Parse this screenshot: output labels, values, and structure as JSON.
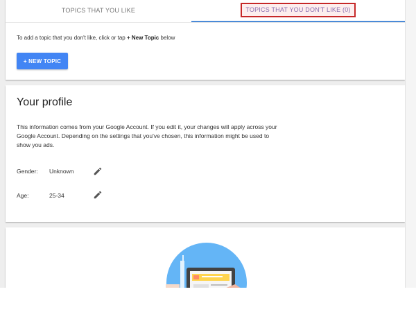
{
  "tabs": {
    "like_label": "TOPICS THAT YOU LIKE",
    "dislike_label": "TOPICS THAT YOU DON'T LIKE (0)",
    "active": "dislike"
  },
  "topics": {
    "help_prefix": "To add a topic that you don't like, click or tap ",
    "help_emphasis": "+ New Topic",
    "help_suffix": " below",
    "new_topic_button": "+ NEW TOPIC"
  },
  "profile": {
    "title": "Your profile",
    "description": "This information comes from your Google Account. If you edit it, your changes will apply across your Google Account. Depending on the settings that you've chosen, this information might be used to show you ads.",
    "fields": [
      {
        "label": "Gender:",
        "value": "Unknown"
      },
      {
        "label": "Age:",
        "value": "25-34"
      }
    ]
  },
  "colors": {
    "accent": "#4285f4",
    "tab_indicator": "#4a8ad8",
    "highlight_border": "#c62828"
  },
  "icons": {
    "edit": "pencil-icon"
  }
}
